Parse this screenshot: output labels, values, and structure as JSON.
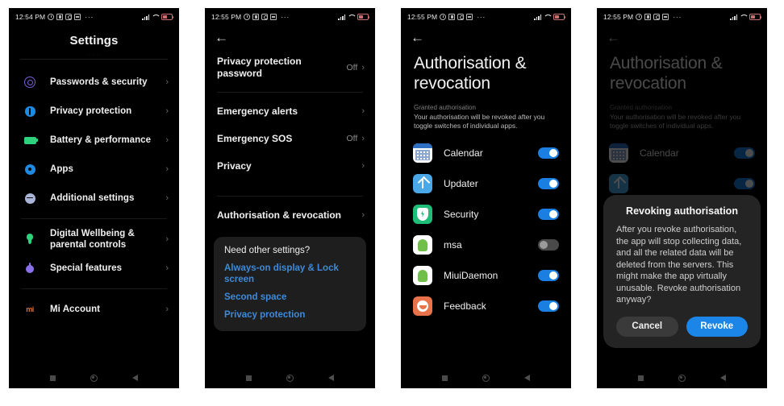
{
  "panels": [
    {
      "id": "settings",
      "statusbar": {
        "time": "12:54 PM",
        "icons_left": [
          "alarm-icon",
          "screen-record-icon",
          "do-not-disturb-icon",
          "screenshot-icon",
          "more-dots-icon"
        ],
        "icons_right": [
          "signal-icon",
          "wifi-icon",
          "battery-icon"
        ]
      },
      "title": "Settings",
      "items": [
        {
          "label": "Passwords & security",
          "icon": "fingerprint-icon",
          "chevron": "›"
        },
        {
          "label": "Privacy protection",
          "icon": "shield-icon",
          "chevron": "›"
        },
        {
          "label": "Battery & performance",
          "icon": "battery-icon",
          "chevron": "›"
        },
        {
          "label": "Apps",
          "icon": "gear-icon",
          "chevron": "›"
        },
        {
          "label": "Additional settings",
          "icon": "sliders-icon",
          "chevron": "›"
        },
        {
          "label": "Digital Wellbeing & parental controls",
          "icon": "wellbeing-icon",
          "chevron": "›"
        },
        {
          "label": "Special features",
          "icon": "special-features-icon",
          "chevron": "›"
        },
        {
          "label": "Mi Account",
          "icon": "mi-logo-icon",
          "chevron": "›"
        }
      ],
      "navbar": [
        "recents-square-icon",
        "home-circle-icon",
        "back-triangle-icon"
      ]
    },
    {
      "id": "privacy-protection",
      "statusbar": {
        "time": "12:55 PM"
      },
      "back": "←",
      "items": [
        {
          "label": "Privacy protection password",
          "value": "Off",
          "chevron": "›"
        },
        {
          "label": "Emergency alerts",
          "value": "",
          "chevron": "›"
        },
        {
          "label": "Emergency SOS",
          "value": "Off",
          "chevron": "›"
        },
        {
          "label": "Privacy",
          "value": "",
          "chevron": "›"
        },
        {
          "label": "Authorisation & revocation",
          "value": "",
          "chevron": "›"
        }
      ],
      "card": {
        "heading": "Need other settings?",
        "links": [
          "Always-on display & Lock screen",
          "Second space",
          "Privacy protection"
        ]
      }
    },
    {
      "id": "authorisation-revocation",
      "statusbar": {
        "time": "12:55 PM"
      },
      "back": "←",
      "title": "Authorisation & revocation",
      "section_label": "Granted authorisation",
      "section_desc": "Your authorisation will be revoked after you toggle switches of individual apps.",
      "apps": [
        {
          "name": "Calendar",
          "icon": "calendar-app-icon",
          "enabled": true
        },
        {
          "name": "Updater",
          "icon": "updater-app-icon",
          "enabled": true
        },
        {
          "name": "Security",
          "icon": "security-app-icon",
          "enabled": true
        },
        {
          "name": "msa",
          "icon": "android-app-icon",
          "enabled": false
        },
        {
          "name": "MiuiDaemon",
          "icon": "android-app-icon",
          "enabled": true
        },
        {
          "name": "Feedback",
          "icon": "feedback-app-icon",
          "enabled": true
        }
      ]
    },
    {
      "id": "revoking-authorisation-dialog",
      "statusbar": {
        "time": "12:55 PM"
      },
      "back": "←",
      "title": "Authorisation & revocation",
      "section_label": "Granted authorisation",
      "section_desc": "Your authorisation will be revoked after you toggle switches of individual apps.",
      "apps": [
        {
          "name": "Calendar",
          "icon": "calendar-app-icon",
          "enabled": true
        }
      ],
      "dialog": {
        "title": "Revoking authorisation",
        "body": "After you revoke authorisation, the app will stop collecting data, and all the related data will be deleted from the servers. This might make the app virtually unusable. Revoke authorisation anyway?",
        "cancel": "Cancel",
        "confirm": "Revoke"
      }
    }
  ],
  "colors": {
    "accent_blue": "#1a7fe0",
    "link_blue": "#3e8ad9",
    "background": "#000000",
    "card": "#1e1e1e",
    "dialog": "#242424"
  }
}
